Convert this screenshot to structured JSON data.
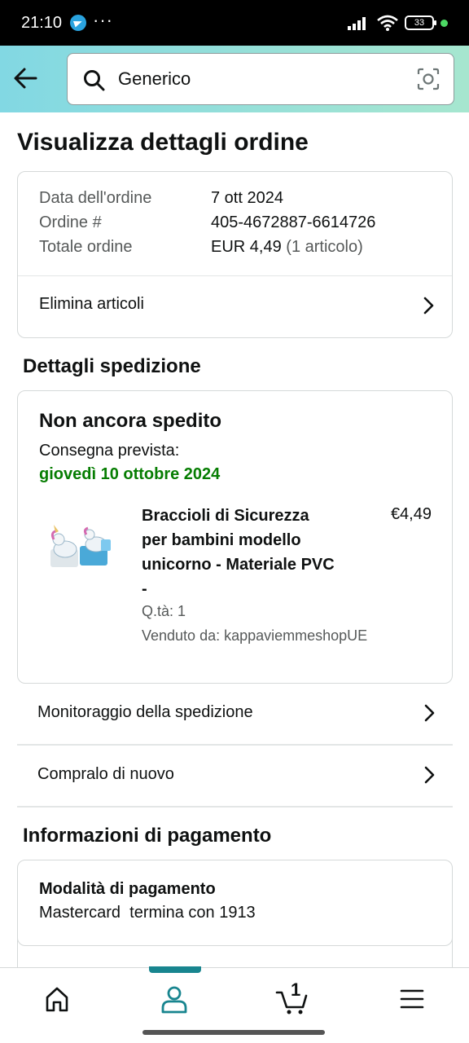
{
  "status_bar": {
    "time": "21:10",
    "dots": "···",
    "battery": "33"
  },
  "search": {
    "value": "Generico"
  },
  "page": {
    "title": "Visualizza dettagli ordine"
  },
  "order": {
    "date_label": "Data dell'ordine",
    "date_value": "7 ott 2024",
    "number_label": "Ordine #",
    "number_value": "405-4672887-6614726",
    "total_label": "Totale ordine",
    "total_value": "EUR 4,49",
    "total_items": "(1 articolo)",
    "delete_label": "Elimina articoli"
  },
  "shipping": {
    "section_title": "Dettagli spedizione",
    "status": "Non ancora spedito",
    "expected_label": "Consegna prevista:",
    "expected_date": "giovedì 10 ottobre 2024",
    "product": {
      "title": "Braccioli di Sicurezza per bambini modello unicorno - Materiale PVC -",
      "price": "€4,49",
      "qty": "Q.tà: 1",
      "seller": "Venduto da: kappaviemmeshopUE"
    },
    "track_label": "Monitoraggio della spedizione",
    "buy_again_label": "Compralo di nuovo"
  },
  "payment": {
    "section_title": "Informazioni di pagamento",
    "method_label": "Modalità di pagamento",
    "method_value": "Mastercard  termina con 1913"
  },
  "bottom_nav": {
    "items": [
      "home-icon",
      "account-icon",
      "cart-icon",
      "menu-icon"
    ],
    "cart_count": "1",
    "active": "account-icon"
  },
  "colors": {
    "accent": "#18858f",
    "delivery_green": "#067d02",
    "header_gradient_start": "#82d8e3",
    "header_gradient_end": "#a6e6cf"
  }
}
